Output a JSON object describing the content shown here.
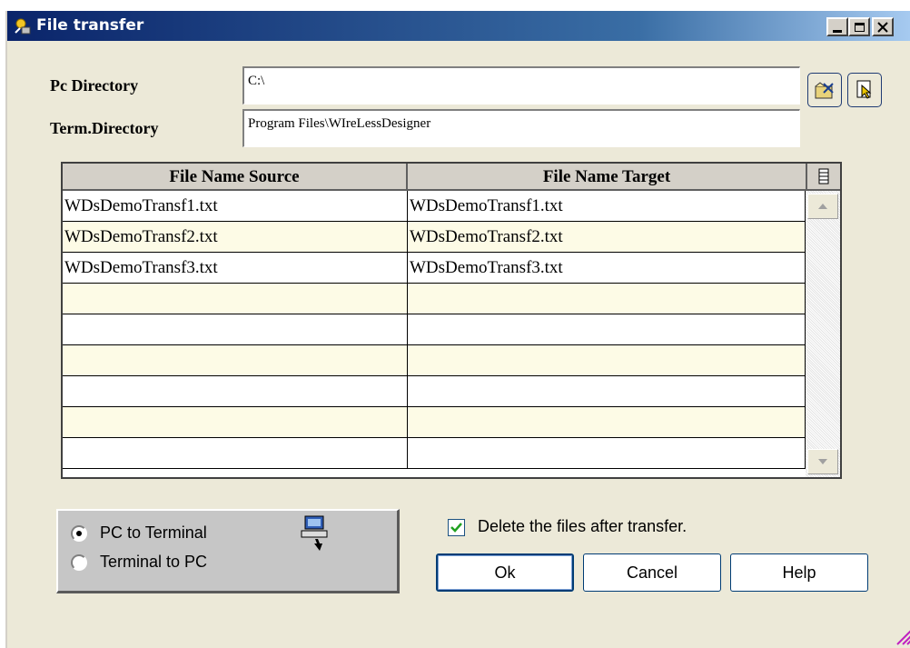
{
  "window": {
    "title": "File transfer"
  },
  "title_controls": {
    "minimize_icon": "minimize-icon",
    "maximize_icon": "maximize-icon",
    "close_icon": "close-icon"
  },
  "pc_directory": {
    "label": "Pc Directory",
    "value": "C:\\"
  },
  "term_directory": {
    "label": "Term.Directory",
    "value": "Program Files\\WIreLessDesigner"
  },
  "toolbar": {
    "browse_icon": "browse-folder-icon",
    "select_icon": "select-file-icon"
  },
  "grid": {
    "columns": [
      "File Name Source",
      "File Name Target"
    ],
    "rows": [
      [
        "WDsDemoTransf1.txt",
        "WDsDemoTransf1.txt"
      ],
      [
        "WDsDemoTransf2.txt",
        "WDsDemoTransf2.txt"
      ],
      [
        "WDsDemoTransf3.txt",
        "WDsDemoTransf3.txt"
      ],
      [
        "",
        ""
      ],
      [
        "",
        ""
      ],
      [
        "",
        ""
      ],
      [
        "",
        ""
      ],
      [
        "",
        ""
      ],
      [
        "",
        ""
      ]
    ],
    "row_colors": [
      "#ffffff",
      "#fdfbe6"
    ]
  },
  "direction": {
    "options": [
      "PC to Terminal",
      "Terminal to PC"
    ],
    "selected": "PC to Terminal"
  },
  "delete_after": {
    "label": "Delete the files after transfer.",
    "checked": true
  },
  "buttons": {
    "ok": "Ok",
    "cancel": "Cancel",
    "help": "Help"
  },
  "colors": {
    "titlebar": "#0a246a",
    "dialog_bg": "#ece9d8",
    "button_border": "#003c74",
    "check_green": "#21a121"
  }
}
